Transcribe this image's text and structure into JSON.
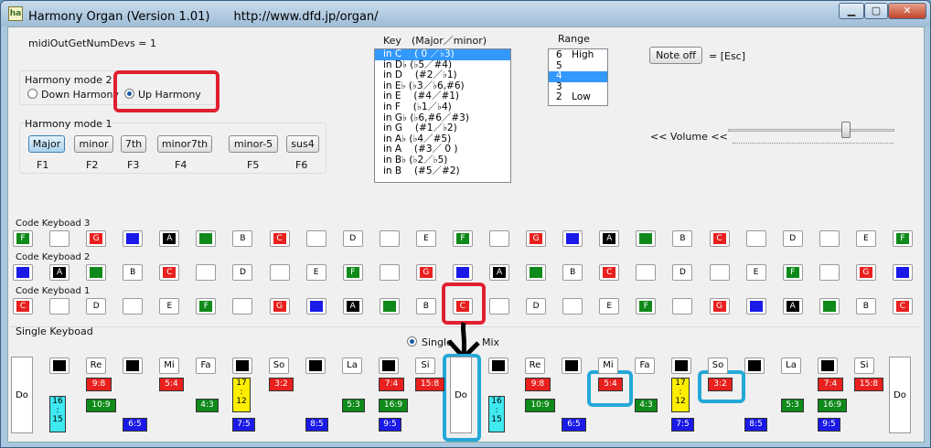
{
  "window": {
    "title": "Harmony Organ (Version 1.01)",
    "url": "http://www.dfd.jp/organ/",
    "icon_label": "ha"
  },
  "midi": "midiOutGetNumDevs = 1",
  "harmony_mode2": {
    "label": "Harmony mode 2",
    "options": [
      "Down Harmony",
      "Up Harmony"
    ],
    "selected": "Up Harmony"
  },
  "harmony_mode1": {
    "label": "Harmony mode 1",
    "buttons": [
      {
        "label": "Major",
        "fkey": "F1",
        "selected": true
      },
      {
        "label": "minor",
        "fkey": "F2",
        "selected": false
      },
      {
        "label": "7th",
        "fkey": "F3",
        "selected": false
      },
      {
        "label": "minor7th",
        "fkey": "F4",
        "selected": false
      },
      {
        "label": "minor-5",
        "fkey": "F5",
        "selected": false
      },
      {
        "label": "sus4",
        "fkey": "F6",
        "selected": false
      }
    ]
  },
  "key_list": {
    "label": "Key　(Major／minor)",
    "items": [
      "in C　 ( 0 ／♭3)",
      "in D♭ (♭5／#4)",
      "in D　 (#2／♭1)",
      "in E♭ (♭3／♭6,#6)",
      "in E　 (#4／#1)",
      "in F　 (♭1／♭4)",
      "in G♭ (♭6,#6／#3)",
      "in G　 (#1／♭2)",
      "in A♭ (♭4／#5)",
      "in A　 (#3／ 0 )",
      "in B♭ (♭2／♭5)",
      "in B　 (#5／#2)"
    ],
    "selected": 0
  },
  "range_list": {
    "label": "Range",
    "items": [
      "6　High",
      "5",
      "4",
      "3",
      "2　Low"
    ],
    "selected": 2
  },
  "note_off": {
    "button": "Note off",
    "hint": "= [Esc]"
  },
  "volume": {
    "label": "<< Volume <<",
    "level": 0.7
  },
  "code_keyboards": [
    {
      "label": "Code Keyboad 3",
      "keys": [
        "F",
        "",
        "G",
        "blue",
        "A",
        "green",
        "B",
        "C",
        "",
        "D",
        "",
        "E",
        "F",
        "",
        "G",
        "blue",
        "A",
        "green",
        "B",
        "C",
        "",
        "D",
        "",
        "E",
        "F"
      ]
    },
    {
      "label": "Code Keyboad 2",
      "keys": [
        "blue",
        "A",
        "green",
        "B",
        "C",
        "",
        "D",
        "",
        "E",
        "F",
        "",
        "G",
        "blue",
        "A",
        "green",
        "B",
        "C",
        "",
        "D",
        "",
        "E",
        "F",
        "",
        "G",
        "blue"
      ]
    },
    {
      "label": "Code Keyboad 1",
      "keys": [
        "C",
        "",
        "D",
        "",
        "E",
        "F",
        "",
        "G",
        "blue",
        "A",
        "green",
        "B",
        "C",
        "",
        "D",
        "",
        "E",
        "F",
        "",
        "G",
        "blue",
        "A",
        "green",
        "B",
        "C"
      ]
    }
  ],
  "single": {
    "label": "Single Keyboad",
    "options": [
      "Single",
      "Mix"
    ],
    "selected": "Single",
    "labels": [
      "Do",
      "Re",
      "Mi",
      "Fa",
      "So",
      "La",
      "Si"
    ],
    "ratios": {
      "re": "9:8",
      "mi": "5:4",
      "so": "3:2",
      "si": "7:4",
      "la2": "15:8",
      "re2": "10:9",
      "fa": "4:3",
      "la": "5:3",
      "si2": "16:9",
      "mi2": "6:5",
      "sox": "7:5",
      "lax": "8:5",
      "six": "9:5",
      "do": "16\n:\n15",
      "yel": "17\n:\n12"
    }
  },
  "colors": {
    "red": "#e8201e",
    "green": "#0f8a1a",
    "blue": "#1a1ae8",
    "black": "#000000",
    "yellow": "#ffee00",
    "cyan": "#40e8f0"
  }
}
